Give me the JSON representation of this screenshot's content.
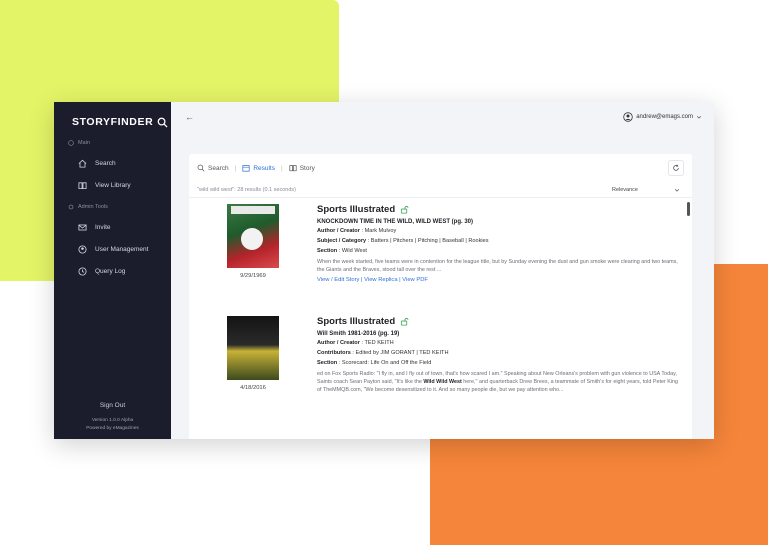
{
  "brand": {
    "name": "STORYFINDER"
  },
  "sidebar": {
    "main_label": "Main",
    "main_items": [
      {
        "label": "Search",
        "icon": "home-icon"
      },
      {
        "label": "View Library",
        "icon": "book-icon"
      }
    ],
    "admin_label": "Admin Tools",
    "admin_items": [
      {
        "label": "Invite",
        "icon": "mail-icon"
      },
      {
        "label": "User Management",
        "icon": "user-icon"
      },
      {
        "label": "Query Log",
        "icon": "clock-icon"
      }
    ],
    "footer": {
      "sign_out": "Sign Out",
      "version": "Version 1.0.0 Alpha",
      "powered_by": "Powered by eMagazines"
    }
  },
  "topbar": {
    "back": "←",
    "user_email": "andrew@emags.com"
  },
  "tabs": [
    {
      "label": "Search",
      "icon": "search-icon"
    },
    {
      "label": "Results",
      "icon": "calendar-icon"
    },
    {
      "label": "Story",
      "icon": "book-icon"
    }
  ],
  "results_summary": "\"wild wild west\": 28 results (0.1 seconds)",
  "sort": {
    "selected": "Relevance"
  },
  "results": [
    {
      "date": "9/29/1969",
      "title": "Sports Illustrated",
      "headline": "KNOCKDOWN TIME IN THE WILD, WILD WEST (pg. 30)",
      "author_label": "Author / Creator",
      "author": "Mark Mulvoy",
      "subject_label": "Subject / Category",
      "subject": "Batters | Pitchers | Pitching | Baseball | Rookies",
      "section_label": "Section",
      "section": "Wild West",
      "snippet": "When the week started, five teams were in contention for the league title, but by Sunday evening the dust and gun smoke were clearing and two teams, the Giants and the Braves, stood tall over the rest ...",
      "links": "View / Edit Story | View Replica | View PDF"
    },
    {
      "date": "4/18/2016",
      "title": "Sports Illustrated",
      "headline": "Will Smith 1981-2016 (pg. 19)",
      "author_label": "Author / Creator",
      "author": "TED KEITH",
      "contributors_label": "Contributors",
      "contributors": "Edited by JIM GORANT | TED KEITH",
      "section_label": "Section",
      "section": "Scorecard: Life On and Off the Field",
      "snippet_before": "ed on Fox Sports Radio: \"I fly in, and I fly out of town, that's how scared I am.\" Speaking about New Orleans's problem with gun violence to USA Today, Saints coach Sean Payton said, \"It's like the ",
      "snippet_bold": "Wild Wild West",
      "snippet_after": " here,\" and quarterback Drew Brees, a teammate of Smith's for eight years, told Peter King of TheMMQB.com, \"We become desensitized to it. And so many people die, but we pay attention who..."
    }
  ],
  "colors": {
    "sidebar": "#1b1d2d",
    "accent": "#2f6fd8",
    "green_blob": "#e4f467",
    "orange_blob": "#f5853a"
  }
}
